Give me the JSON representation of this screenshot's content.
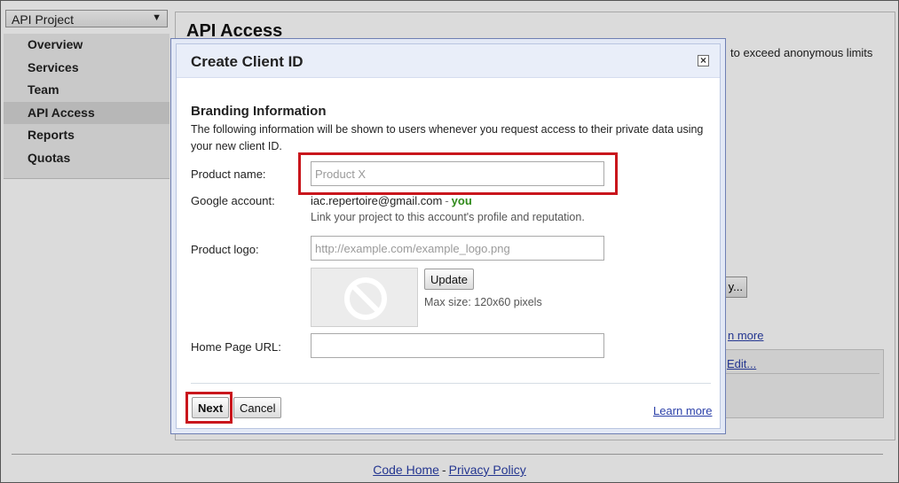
{
  "project_selector": {
    "value": "API Project"
  },
  "sidebar": {
    "items": [
      {
        "label": "Overview"
      },
      {
        "label": "Services"
      },
      {
        "label": "Team"
      },
      {
        "label": "API Access",
        "active": true
      },
      {
        "label": "Reports"
      },
      {
        "label": "Quotas"
      }
    ]
  },
  "main": {
    "title": "API Access",
    "blurb_partial": "to exceed anonymous limits",
    "button_partial": "y...",
    "link_partial": "n more",
    "edit_partial": "Edit..."
  },
  "footer": {
    "code_home": "Code Home",
    "separator": "-",
    "privacy": "Privacy Policy"
  },
  "dialog": {
    "title": "Create Client ID",
    "close_symbol": "×",
    "section_title": "Branding Information",
    "section_desc": "The following information will be shown to users whenever you request access to their private data using your new client ID.",
    "product_name": {
      "label": "Product name:",
      "placeholder": "Product X",
      "value": ""
    },
    "google_account": {
      "label": "Google account:",
      "email": "iac.repertoire@gmail.com",
      "dash": "-",
      "you": "you",
      "hint": "Link your project to this account's profile and reputation."
    },
    "product_logo": {
      "label": "Product logo:",
      "placeholder": "http://example.com/example_logo.png",
      "update_label": "Update",
      "max_size": "Max size: 120x60 pixels"
    },
    "home_page": {
      "label": "Home Page URL:",
      "value": ""
    },
    "next_label": "Next",
    "cancel_label": "Cancel",
    "learn_more": "Learn more"
  },
  "colors": {
    "highlight": "#c9161c",
    "link": "#2a3fa8",
    "you": "#2f8a1a",
    "dialog_header": "#e9eef9"
  }
}
